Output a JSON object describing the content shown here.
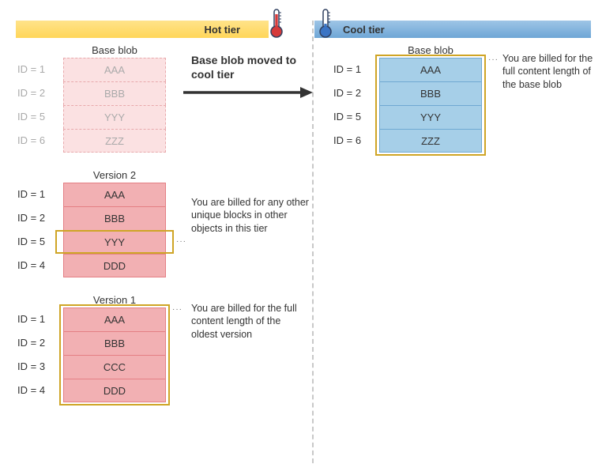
{
  "hot_tier_label": "Hot tier",
  "cool_tier_label": "Cool tier",
  "arrow_label": "Base blob moved to cool tier",
  "hot": {
    "base": {
      "title": "Base blob",
      "rows": [
        {
          "id": "ID = 1",
          "val": "AAA"
        },
        {
          "id": "ID = 2",
          "val": "BBB"
        },
        {
          "id": "ID = 5",
          "val": "YYY"
        },
        {
          "id": "ID = 6",
          "val": "ZZZ"
        }
      ]
    },
    "v2": {
      "title": "Version 2",
      "rows": [
        {
          "id": "ID = 1",
          "val": "AAA"
        },
        {
          "id": "ID = 2",
          "val": "BBB"
        },
        {
          "id": "ID = 5",
          "val": "YYY"
        },
        {
          "id": "ID = 4",
          "val": "DDD"
        }
      ],
      "annotation": "You are billed for any other unique blocks in other objects in this tier"
    },
    "v1": {
      "title": "Version 1",
      "rows": [
        {
          "id": "ID = 1",
          "val": "AAA"
        },
        {
          "id": "ID = 2",
          "val": "BBB"
        },
        {
          "id": "ID = 3",
          "val": "CCC"
        },
        {
          "id": "ID = 4",
          "val": "DDD"
        }
      ],
      "annotation": "You are billed for the full content length of the oldest version"
    }
  },
  "cool": {
    "base": {
      "title": "Base blob",
      "rows": [
        {
          "id": "ID = 1",
          "val": "AAA"
        },
        {
          "id": "ID = 2",
          "val": "BBB"
        },
        {
          "id": "ID = 5",
          "val": "YYY"
        },
        {
          "id": "ID = 6",
          "val": "ZZZ"
        }
      ],
      "annotation": "You are billed for the full content length of the base blob"
    }
  }
}
